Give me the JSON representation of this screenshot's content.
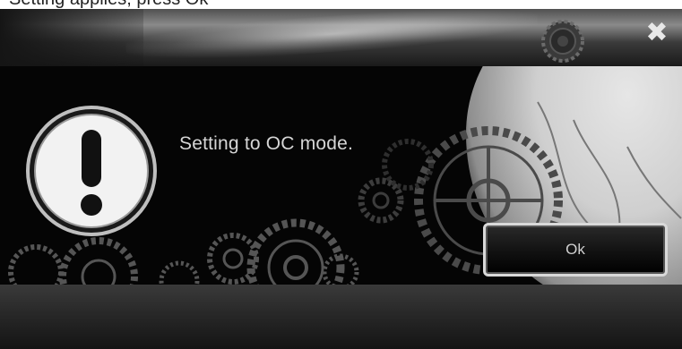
{
  "window": {
    "top_caption": "Setting applies, press Ok"
  },
  "header": {
    "close_glyph": "✖",
    "close_icon": "close-icon"
  },
  "dialog": {
    "icon": "exclamation-icon",
    "message": "Setting to  OC mode.",
    "ok_label": "Ok"
  },
  "colors": {
    "background": "#000000",
    "text": "#d6d6d6",
    "button_border": "#d9d9d9"
  }
}
